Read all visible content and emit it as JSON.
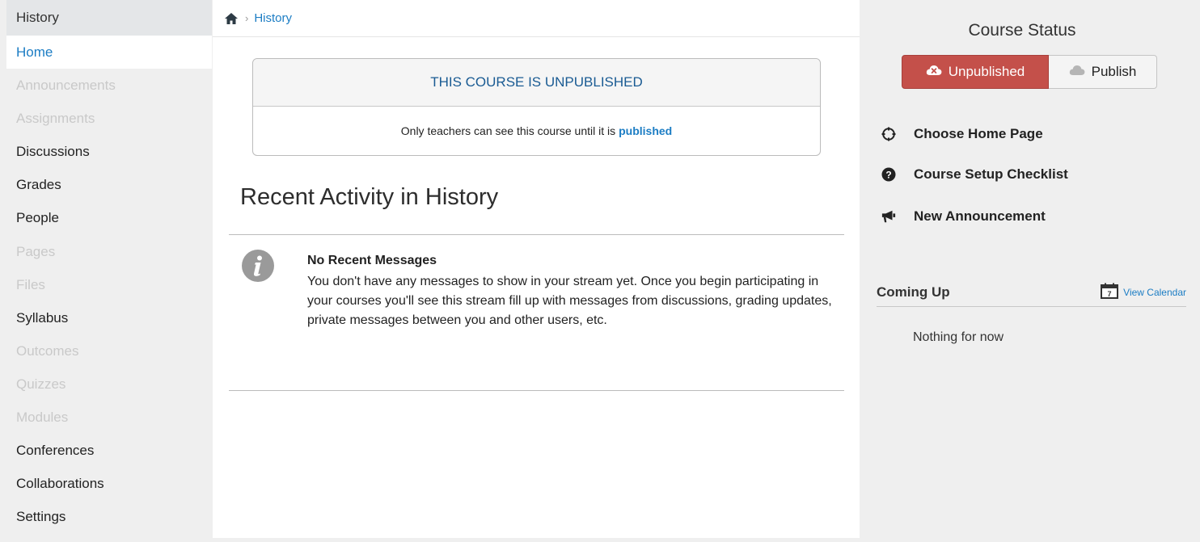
{
  "sidebar": {
    "course_title": "History",
    "items": [
      {
        "label": "Home",
        "state": "active"
      },
      {
        "label": "Announcements",
        "state": "disabled"
      },
      {
        "label": "Assignments",
        "state": "disabled"
      },
      {
        "label": "Discussions",
        "state": "normal"
      },
      {
        "label": "Grades",
        "state": "normal"
      },
      {
        "label": "People",
        "state": "normal"
      },
      {
        "label": "Pages",
        "state": "disabled"
      },
      {
        "label": "Files",
        "state": "disabled"
      },
      {
        "label": "Syllabus",
        "state": "normal"
      },
      {
        "label": "Outcomes",
        "state": "disabled"
      },
      {
        "label": "Quizzes",
        "state": "disabled"
      },
      {
        "label": "Modules",
        "state": "disabled"
      },
      {
        "label": "Conferences",
        "state": "normal"
      },
      {
        "label": "Collaborations",
        "state": "normal"
      },
      {
        "label": "Settings",
        "state": "normal"
      }
    ]
  },
  "breadcrumb": {
    "home_icon": "home-icon",
    "separator": "›",
    "current": "History"
  },
  "unpublished_notice": {
    "heading": "THIS COURSE IS UNPUBLISHED",
    "body_text": "Only teachers can see this course until it is",
    "body_link": "published"
  },
  "recent_activity": {
    "title": "Recent Activity in History",
    "icon": "info-icon",
    "message_title": "No Recent Messages",
    "message_text": "You don't have any messages to show in your stream yet. Once you begin participating in your courses you'll see this stream fill up with messages from discussions, grading updates, private messages between you and other users, etc."
  },
  "course_status": {
    "title": "Course Status",
    "unpublished_label": "Unpublished",
    "publish_label": "Publish"
  },
  "actions": [
    {
      "label": "Choose Home Page",
      "icon": "target-icon"
    },
    {
      "label": "Course Setup Checklist",
      "icon": "question-icon"
    },
    {
      "label": "New Announcement",
      "icon": "megaphone-icon"
    }
  ],
  "coming_up": {
    "title": "Coming Up",
    "view_calendar": "View Calendar",
    "calendar_day": "7",
    "empty_text": "Nothing for now"
  },
  "colors": {
    "link": "#1c7dc4",
    "unpublished_button": "#c4504a",
    "active_nav": "#1c7dc4",
    "disabled_nav": "#c9c9c9"
  }
}
